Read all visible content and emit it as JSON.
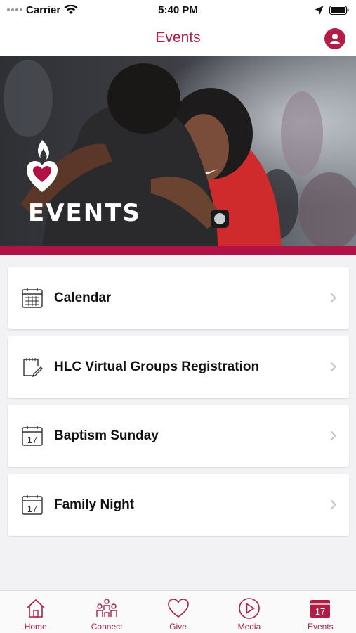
{
  "status_bar": {
    "carrier": "Carrier",
    "time": "5:40 PM"
  },
  "nav": {
    "title": "Events",
    "profile_icon": "person-icon"
  },
  "hero": {
    "word": "EVENTS",
    "logo_icon": "flame-heart-logo"
  },
  "list": {
    "items": [
      {
        "label": "Calendar",
        "icon": "calendar-grid-icon"
      },
      {
        "label": "HLC Virtual Groups Registration",
        "icon": "notepad-edit-icon"
      },
      {
        "label": "Baptism Sunday",
        "icon": "calendar-day-icon",
        "day": "17"
      },
      {
        "label": "Family Night",
        "icon": "calendar-day-icon",
        "day": "17"
      }
    ]
  },
  "tabs": [
    {
      "label": "Home",
      "icon": "home-icon"
    },
    {
      "label": "Connect",
      "icon": "people-icon"
    },
    {
      "label": "Give",
      "icon": "heart-icon"
    },
    {
      "label": "Media",
      "icon": "play-circle-icon"
    },
    {
      "label": "Events",
      "icon": "calendar-filled-icon",
      "day": "17"
    }
  ],
  "colors": {
    "accent": "#b01e48",
    "hero_stripe": "#b31246",
    "background": "#f2f2f4"
  }
}
